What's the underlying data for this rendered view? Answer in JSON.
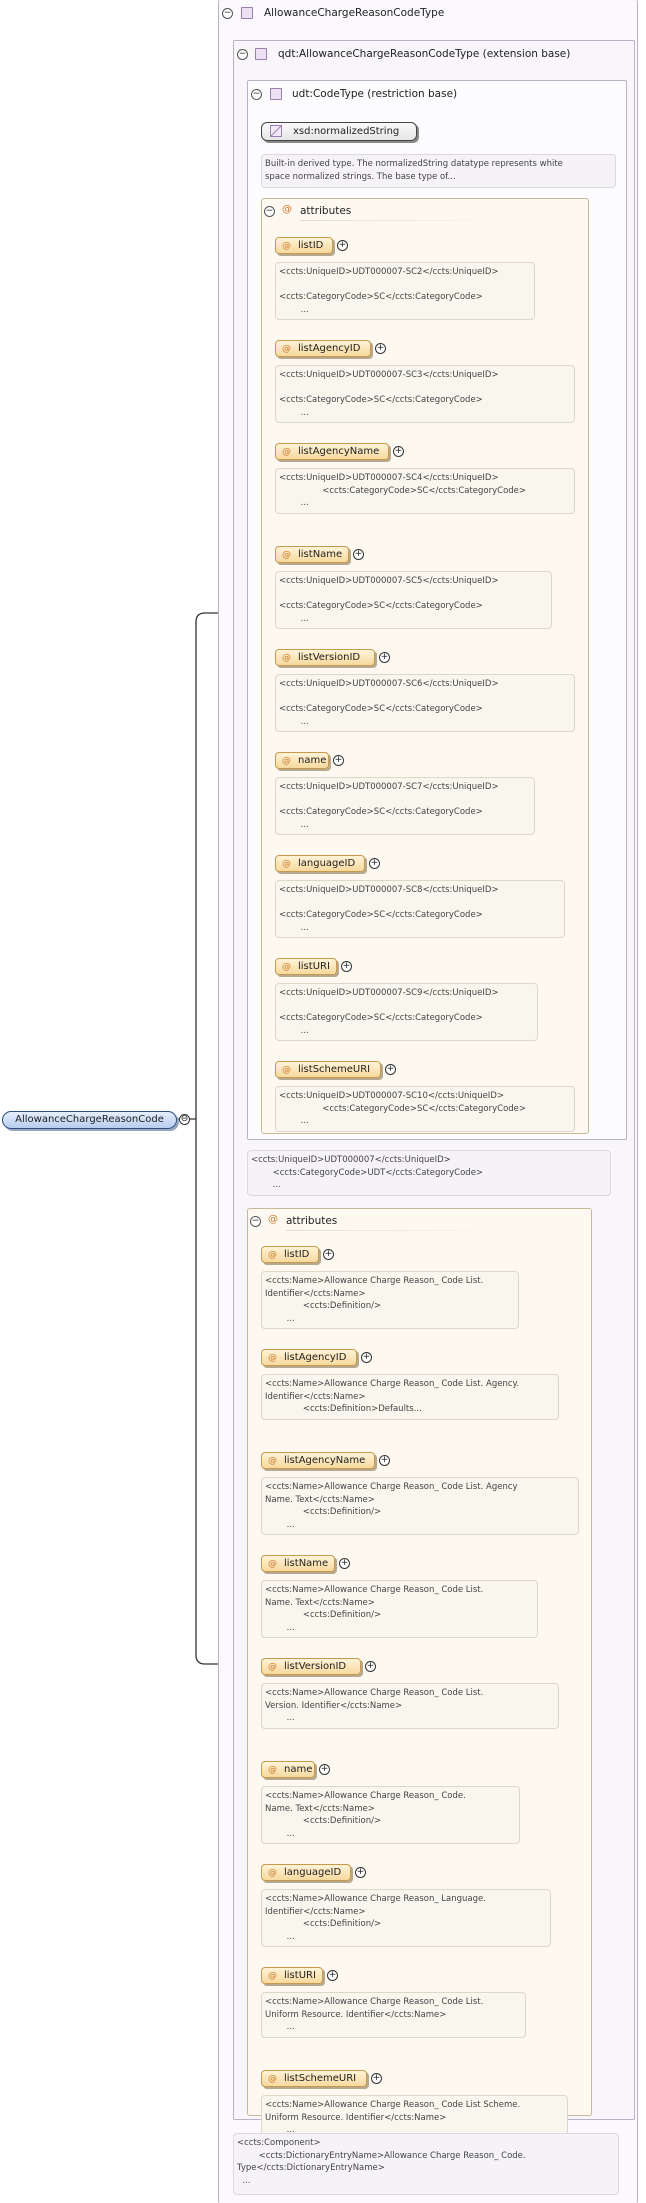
{
  "root_element": {
    "name": "AllowanceChargeReasonCode"
  },
  "complex_type": {
    "name": "AllowanceChargeReasonCodeType"
  },
  "qdt_type": {
    "name": "qdt:AllowanceChargeReasonCodeType (extension base)"
  },
  "udt_type": {
    "name": "udt:CodeType (restriction base)"
  },
  "xsd_type": {
    "name": "xsd:normalizedString",
    "doc": "Built-in derived type. The normalizedString datatype represents white\nspace normalized strings. The base type of..."
  },
  "udt_attributes": {
    "label": "attributes",
    "items": [
      {
        "name": "listID",
        "doc": "<ccts:UniqueID>UDT000007-SC2</ccts:UniqueID>\n\n<ccts:CategoryCode>SC</ccts:CategoryCode>\n        ..."
      },
      {
        "name": "listAgencyID",
        "doc": "<ccts:UniqueID>UDT000007-SC3</ccts:UniqueID>\n\n<ccts:CategoryCode>SC</ccts:CategoryCode>\n        ..."
      },
      {
        "name": "listAgencyName",
        "doc": "<ccts:UniqueID>UDT000007-SC4</ccts:UniqueID>\n                <ccts:CategoryCode>SC</ccts:CategoryCode>\n        ..."
      },
      {
        "name": "listName",
        "doc": "<ccts:UniqueID>UDT000007-SC5</ccts:UniqueID>\n\n<ccts:CategoryCode>SC</ccts:CategoryCode>\n        ..."
      },
      {
        "name": "listVersionID",
        "doc": "<ccts:UniqueID>UDT000007-SC6</ccts:UniqueID>\n\n<ccts:CategoryCode>SC</ccts:CategoryCode>\n        ..."
      },
      {
        "name": "name",
        "doc": "<ccts:UniqueID>UDT000007-SC7</ccts:UniqueID>\n\n<ccts:CategoryCode>SC</ccts:CategoryCode>\n        ..."
      },
      {
        "name": "languageID",
        "doc": "<ccts:UniqueID>UDT000007-SC8</ccts:UniqueID>\n\n<ccts:CategoryCode>SC</ccts:CategoryCode>\n        ..."
      },
      {
        "name": "listURI",
        "doc": "<ccts:UniqueID>UDT000007-SC9</ccts:UniqueID>\n\n<ccts:CategoryCode>SC</ccts:CategoryCode>\n        ..."
      },
      {
        "name": "listSchemeURI",
        "doc": "<ccts:UniqueID>UDT000007-SC10</ccts:UniqueID>\n                <ccts:CategoryCode>SC</ccts:CategoryCode>\n        ..."
      }
    ]
  },
  "udt_doc": "<ccts:UniqueID>UDT000007</ccts:UniqueID>\n        <ccts:CategoryCode>UDT</ccts:CategoryCode>\n        ...",
  "qdt_attributes": {
    "label": "attributes",
    "items": [
      {
        "name": "listID",
        "doc": "<ccts:Name>Allowance Charge Reason_ Code List.\nIdentifier</ccts:Name>\n              <ccts:Definition/>\n        ..."
      },
      {
        "name": "listAgencyID",
        "doc": "<ccts:Name>Allowance Charge Reason_ Code List. Agency.\nIdentifier</ccts:Name>\n              <ccts:Definition>Defaults..."
      },
      {
        "name": "listAgencyName",
        "doc": "<ccts:Name>Allowance Charge Reason_ Code List. Agency\nName. Text</ccts:Name>\n              <ccts:Definition/>\n        ..."
      },
      {
        "name": "listName",
        "doc": "<ccts:Name>Allowance Charge Reason_ Code List.\nName. Text</ccts:Name>\n              <ccts:Definition/>\n        ..."
      },
      {
        "name": "listVersionID",
        "doc": "<ccts:Name>Allowance Charge Reason_ Code List.\nVersion. Identifier</ccts:Name>\n        ..."
      },
      {
        "name": "name",
        "doc": "<ccts:Name>Allowance Charge Reason_ Code.\nName. Text</ccts:Name>\n              <ccts:Definition/>\n        ..."
      },
      {
        "name": "languageID",
        "doc": "<ccts:Name>Allowance Charge Reason_ Language.\nIdentifier</ccts:Name>\n              <ccts:Definition/>\n        ..."
      },
      {
        "name": "listURI",
        "doc": "<ccts:Name>Allowance Charge Reason_ Code List.\nUniform Resource. Identifier</ccts:Name>\n        ..."
      },
      {
        "name": "listSchemeURI",
        "doc": "<ccts:Name>Allowance Charge Reason_ Code List Scheme.\nUniform Resource. Identifier</ccts:Name>\n        ..."
      }
    ]
  },
  "component_doc": "<ccts:Component>\n        <ccts:DictionaryEntryName>Allowance Charge Reason_ Code.\nType</ccts:DictionaryEntryName>\n  ..."
}
